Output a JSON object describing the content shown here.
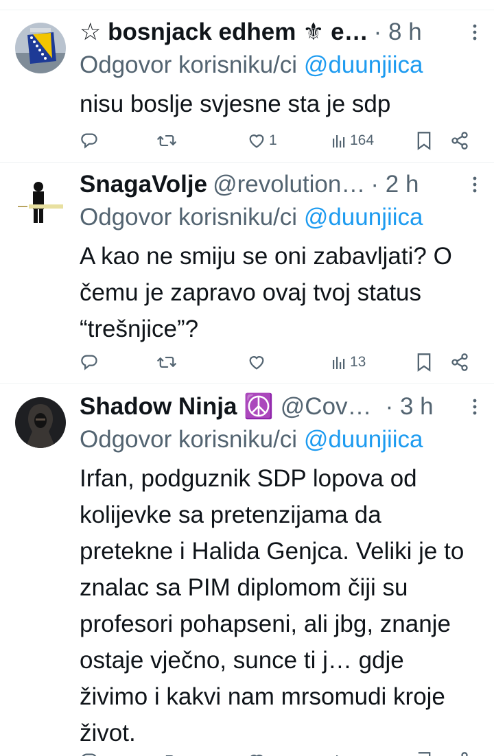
{
  "tweets": [
    {
      "name": "☆ bosnjack edhem ⚜ e…",
      "handle": "",
      "time": "· 8 h",
      "reply_label": "Odgovor korisniku/ci",
      "reply_mention": "@duunjiica",
      "text": "nisu boslje svjesne sta je sdp",
      "avatar": "bosnian-flag",
      "reply_count": "",
      "retweet_count": "",
      "like_count": "1",
      "view_count": "164"
    },
    {
      "name": "SnagaVolje",
      "handle": "@revolution…",
      "time": "· 2 h",
      "reply_label": "Odgovor korisniku/ci",
      "reply_mention": "@duunjiica",
      "text": "A kao ne smiju se oni zabavljati? O čemu je zapravo ovaj tvoj status “trešnjice”?",
      "avatar": "silhouette",
      "reply_count": "",
      "retweet_count": "",
      "like_count": "",
      "view_count": "13"
    },
    {
      "name": "Shadow Ninja ☮️",
      "handle": "@Cov…",
      "time": "· 3 h",
      "reply_label": "Odgovor korisniku/ci",
      "reply_mention": "@duunjiica",
      "text": "Irfan, podguznik SDP lopova od kolijevke sa pretenzijama da pretekne  i Halida Genjca. Veliki je to znalac sa PIM diplomom čiji su profesori pohapseni, ali jbg, znanje ostaje vječno,  sunce ti j… gdje živimo i kakvi nam mrsomudi kroje život.",
      "avatar": "hooded-figure",
      "reply_count": "",
      "retweet_count": "",
      "like_count": "",
      "view_count": ""
    }
  ],
  "colors": {
    "text": "#0f1419",
    "muted": "#536471",
    "mention": "#1d9bf0",
    "divider": "#eff3f4"
  },
  "icons": [
    "reply-icon",
    "retweet-icon",
    "like-icon",
    "views-icon",
    "bookmark-icon",
    "share-icon",
    "more-icon"
  ]
}
